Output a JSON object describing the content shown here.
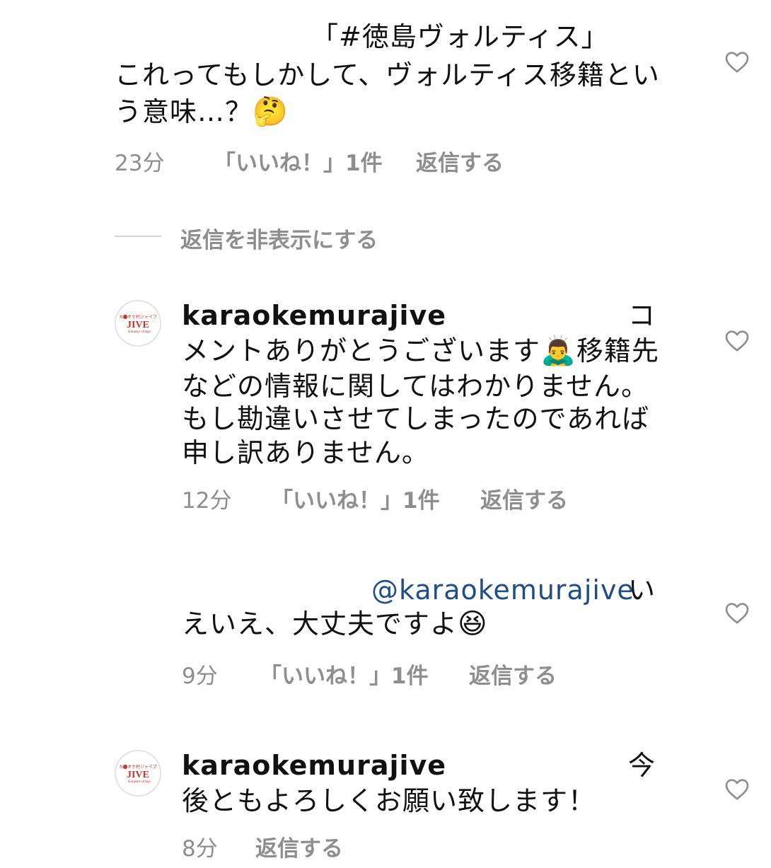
{
  "comments": [
    {
      "line1": "「#徳島ヴォルティス」",
      "line2": "これってもしかして、ヴォルティス移籍とい",
      "line3": "う意味…？",
      "emoji": "🤔",
      "time": "23分",
      "likes": "「いいね！」1件",
      "reply": "返信する"
    }
  ],
  "hide_replies": "返信を非表示にする",
  "replies": [
    {
      "username": "karaokemurajive",
      "text_tail": "コ",
      "line2_a": "メントありがとうございます",
      "emoji": "🙇‍♂️",
      "line2_b": "移籍先",
      "line3": "などの情報に関してはわかりません。",
      "line4": "もし勘違いさせてしまったのであれば",
      "line5": "申し訳ありません。",
      "time": "12分",
      "likes": "「いいね！」1件",
      "reply": "返信する",
      "avatar_text_top": "カラオケ村ジャイブ",
      "avatar_text_main": "JIVE",
      "avatar_text_sub": "Karaoke village"
    },
    {
      "mention": "@karaokemurajive",
      "text_tail": "い",
      "line2": "えいえ、大丈夫ですよ",
      "emoji": "😆",
      "time": "9分",
      "likes": "「いいね！」1件",
      "reply": "返信する"
    },
    {
      "username": "karaokemurajive",
      "text_tail": "今",
      "line2": "後ともよろしくお願い致します！",
      "time": "8分",
      "reply": "返信する",
      "avatar_text_top": "カラオケ村ジャイブ",
      "avatar_text_main": "JIVE",
      "avatar_text_sub": "Karaoke village"
    }
  ],
  "colors": {
    "meta_gray": "#8e8e8e",
    "mention_blue": "#1d4e89",
    "avatar_red": "#c8332d"
  },
  "icons": {
    "like": "heart-outline-icon",
    "avatar": "jive-logo-avatar"
  }
}
